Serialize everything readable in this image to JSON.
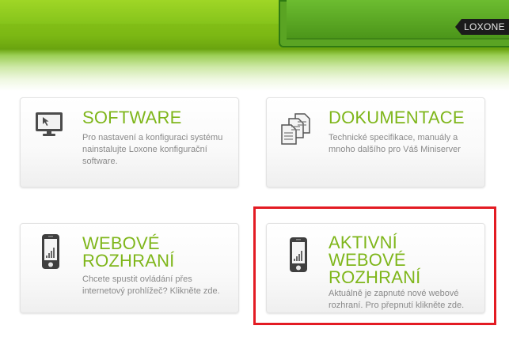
{
  "header": {
    "brand": "LOXONE"
  },
  "cards": [
    {
      "title": "SOFTWARE",
      "desc": "Pro nastavení a konfiguraci systému nainstalujte Loxone konfigurační software.",
      "icon": "monitor-icon"
    },
    {
      "title": "DOKUMENTACE",
      "desc": "Technické specifikace, manuály a mnoho dalšího pro Váš Miniserver",
      "icon": "documents-icon"
    },
    {
      "title": "WEBOVÉ\nROZHRANÍ",
      "desc": "Chcete spustit ovládání přes internetový prohlížeč? Klikněte zde.",
      "icon": "smartphone-icon"
    },
    {
      "title": "AKTIVNÍ\nWEBOVÉ\nROZHRANÍ",
      "desc": "Aktuálně je zapnuté nové webové rozhraní. Pro přepnutí klikněte zde.",
      "icon": "smartphone-icon"
    }
  ],
  "colors": {
    "accent_green": "#7fb61b",
    "highlight_red": "#e31b23"
  }
}
